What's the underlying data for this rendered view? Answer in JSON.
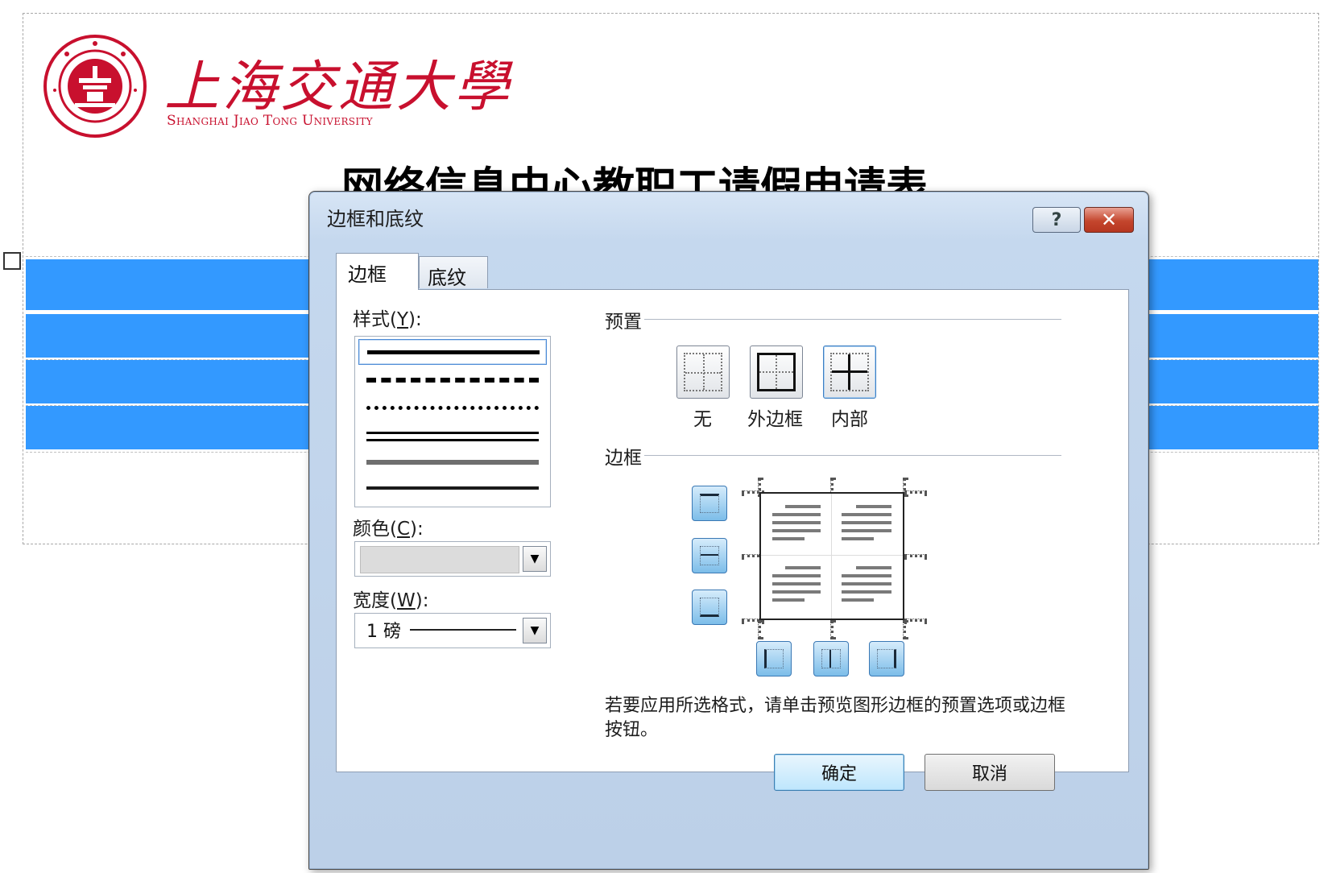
{
  "document": {
    "logo_cn": "上海交通大學",
    "logo_en": "Shanghai Jiao Tong University",
    "title": "网络信息中心教职工请假申请表"
  },
  "dialog": {
    "title": "边框和底纹",
    "help_label": "?",
    "close_label": "✕",
    "tabs": [
      {
        "label": "边框",
        "active": true
      },
      {
        "label": "底纹",
        "active": false
      }
    ],
    "style_label": "样式",
    "style_hotkey": "Y",
    "style_options": [
      "solid",
      "dashed",
      "dotted",
      "double",
      "thick-gray",
      "thin-dark"
    ],
    "color_label": "颜色",
    "color_hotkey": "C",
    "width_label": "宽度",
    "width_hotkey": "W",
    "width_value": "1 磅",
    "preset_section": "预置",
    "presets": [
      {
        "label": "无",
        "icon": "border-none-icon"
      },
      {
        "label": "外边框",
        "icon": "border-box-icon"
      },
      {
        "label": "内部",
        "icon": "border-inside-icon"
      }
    ],
    "border_section": "边框",
    "hint": "若要应用所选格式，请单击预览图形边框的预置选项或边框按钮。",
    "ok_label": "确定",
    "cancel_label": "取消"
  },
  "colors": {
    "table_fill": "#3399ff",
    "logo_red": "#c8102e"
  }
}
